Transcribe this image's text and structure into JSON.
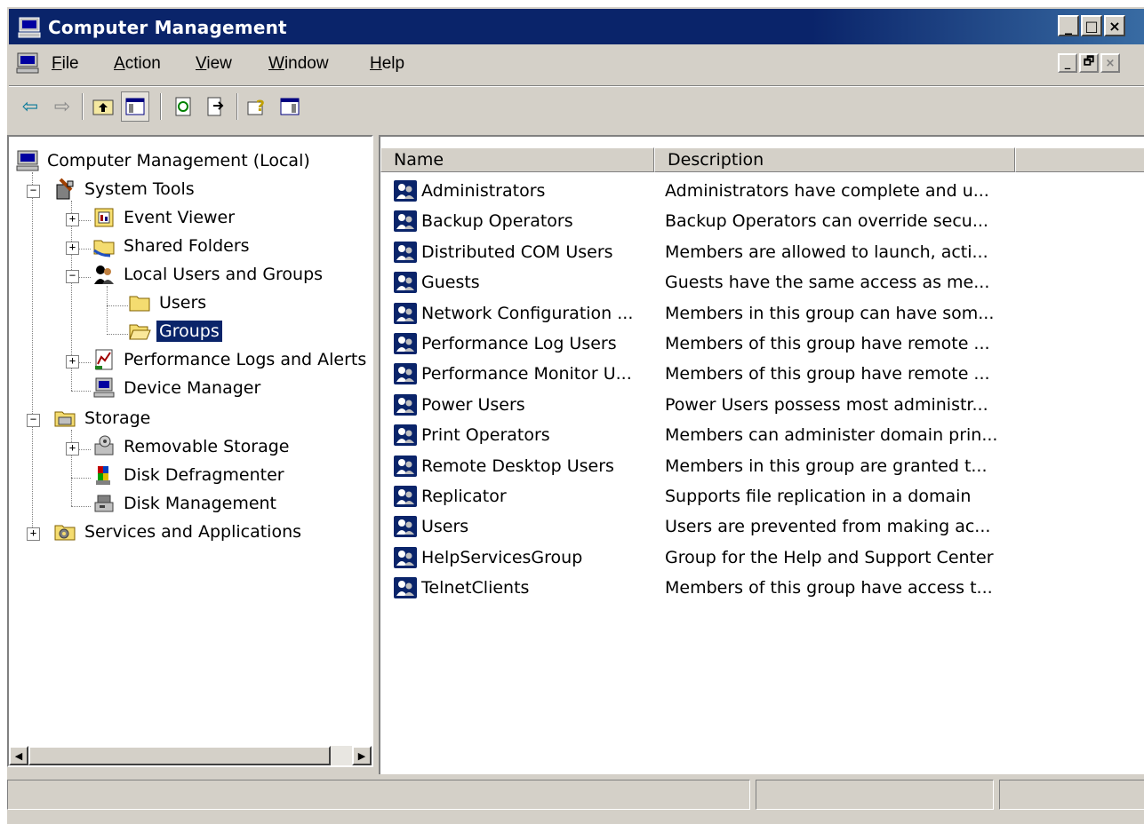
{
  "window": {
    "title": "Computer Management",
    "caption_buttons": [
      "_",
      "□",
      "×"
    ],
    "mdi_buttons": [
      "_",
      "🗗",
      "×"
    ]
  },
  "menu": {
    "items": [
      {
        "label": "File",
        "accel": "F"
      },
      {
        "label": "Action",
        "accel": "A"
      },
      {
        "label": "View",
        "accel": "V"
      },
      {
        "label": "Window",
        "accel": "W"
      },
      {
        "label": "Help",
        "accel": "H"
      }
    ]
  },
  "toolbar": {
    "buttons": [
      "back-icon",
      "forward-icon",
      "up-folder-icon",
      "show-hide-tree-icon",
      "refresh-icon",
      "export-list-icon",
      "help-icon",
      "show-hide-action-pane-icon"
    ]
  },
  "tree": {
    "root": "Computer Management (Local)",
    "system_tools": "System Tools",
    "event_viewer": "Event Viewer",
    "shared_folders": "Shared Folders",
    "local_users_groups": "Local Users and Groups",
    "users": "Users",
    "groups": "Groups",
    "perf_logs": "Performance Logs and Alerts",
    "device_manager": "Device Manager",
    "storage": "Storage",
    "removable_storage": "Removable Storage",
    "disk_defrag": "Disk Defragmenter",
    "disk_mgmt": "Disk Management",
    "services_apps": "Services and Applications",
    "selected": "Groups"
  },
  "list": {
    "columns": [
      "Name",
      "Description"
    ],
    "rows": [
      {
        "name": "Administrators",
        "desc": "Administrators have complete and u..."
      },
      {
        "name": "Backup Operators",
        "desc": "Backup Operators can override secu..."
      },
      {
        "name": "Distributed COM Users",
        "desc": "Members are allowed to launch, acti..."
      },
      {
        "name": "Guests",
        "desc": "Guests have the same access as me..."
      },
      {
        "name": "Network Configuration ...",
        "desc": "Members in this group can have som..."
      },
      {
        "name": "Performance Log Users",
        "desc": "Members of this group have remote ..."
      },
      {
        "name": "Performance Monitor U...",
        "desc": "Members of this group have remote ..."
      },
      {
        "name": "Power Users",
        "desc": "Power Users possess most administr..."
      },
      {
        "name": "Print Operators",
        "desc": "Members can administer domain prin..."
      },
      {
        "name": "Remote Desktop Users",
        "desc": "Members in this group are granted t..."
      },
      {
        "name": "Replicator",
        "desc": "Supports file replication in a domain"
      },
      {
        "name": "Users",
        "desc": "Users are prevented from making ac..."
      },
      {
        "name": "HelpServicesGroup",
        "desc": "Group for the Help and Support Center"
      },
      {
        "name": "TelnetClients",
        "desc": "Members of this group have access t..."
      }
    ]
  },
  "colors": {
    "title_bar": "#0a246a",
    "face": "#d4d0c8",
    "selection": "#0a246a"
  }
}
